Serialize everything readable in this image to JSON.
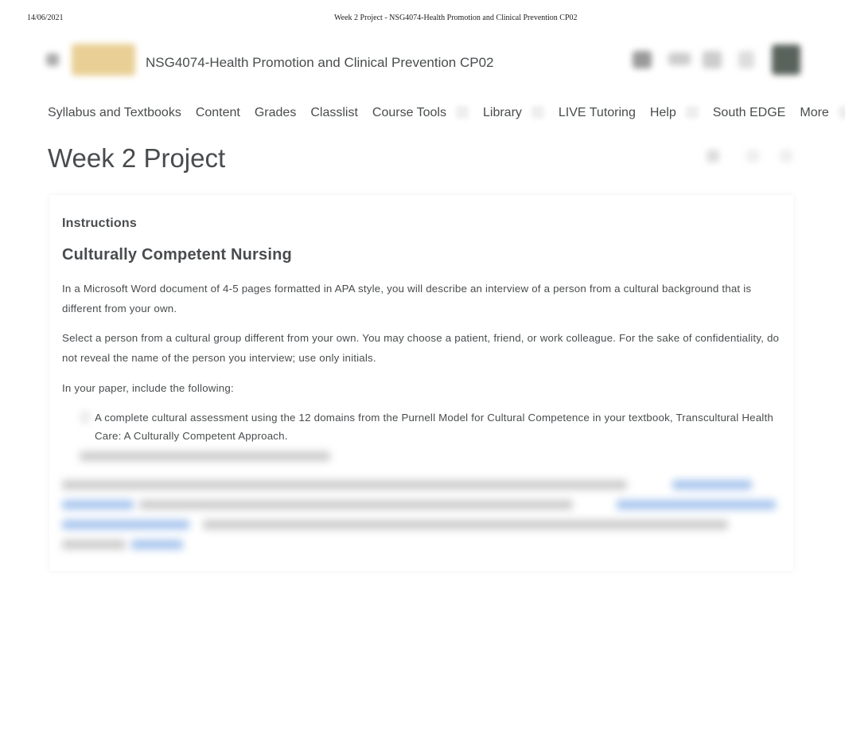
{
  "print_header": {
    "date": "14/06/2021",
    "title": "Week 2 Project - NSG4074-Health Promotion and Clinical Prevention CP02"
  },
  "header": {
    "course_title": "NSG4074-Health Promotion and Clinical Prevention CP02"
  },
  "nav": [
    "Syllabus and Textbooks",
    "Content",
    "Grades",
    "Classlist",
    "Course Tools",
    "Library",
    "LIVE Tutoring",
    "Help",
    "South EDGE",
    "More"
  ],
  "page_title": "Week 2 Project",
  "instructions": {
    "label": "Instructions",
    "heading": "Culturally Competent Nursing",
    "paragraphs": [
      "In a Microsoft Word document of 4-5 pages formatted in APA style, you will describe an interview of a person from a cultural background that is different from your own.",
      "Select a person from a cultural group different from your own. You may choose a patient, friend, or work colleague. For the sake of confidentiality, do not reveal the name of the person you interview; use only initials.",
      "In your paper, include the following:"
    ],
    "list": [
      "A complete cultural assessment using the 12 domains from the Purnell Model for Cultural Competence in your textbook, Transcultural Health Care: A Culturally Competent Approach."
    ]
  }
}
